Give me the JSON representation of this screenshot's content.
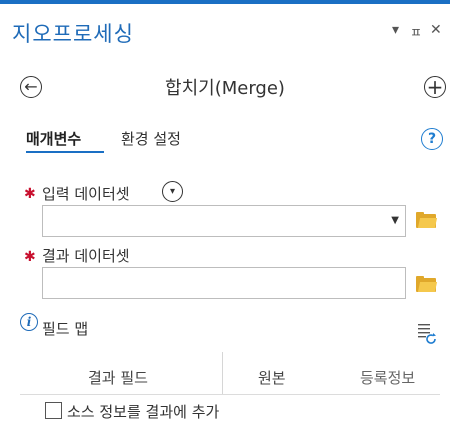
{
  "pane": {
    "title": "지오프로세싱",
    "menu_glyph": "▾",
    "pin_glyph": "ㅍ",
    "close_glyph": "✕"
  },
  "tool": {
    "back_glyph": "←",
    "title": "합치기(Merge)",
    "add_glyph": "+"
  },
  "tabs": [
    {
      "label": "매개변수",
      "active": true
    },
    {
      "label": "환경 설정",
      "active": false
    }
  ],
  "help_glyph": "?",
  "params": {
    "required_marker": "✱",
    "input": {
      "label": "입력 데이터셋",
      "value": "",
      "dropdown_glyph": "▼"
    },
    "output": {
      "label": "결과 데이터셋",
      "value": ""
    },
    "field_map": {
      "info_glyph": "i",
      "label": "필드 맵",
      "columns": [
        "결과 필드",
        "원본",
        "등록정보"
      ]
    },
    "add_source_info": {
      "label": "소스 정보를 결과에 추가",
      "checked": false
    }
  },
  "colors": {
    "accent": "#1a6fc4",
    "required": "#c8102e",
    "folder": "#f5c84c"
  }
}
